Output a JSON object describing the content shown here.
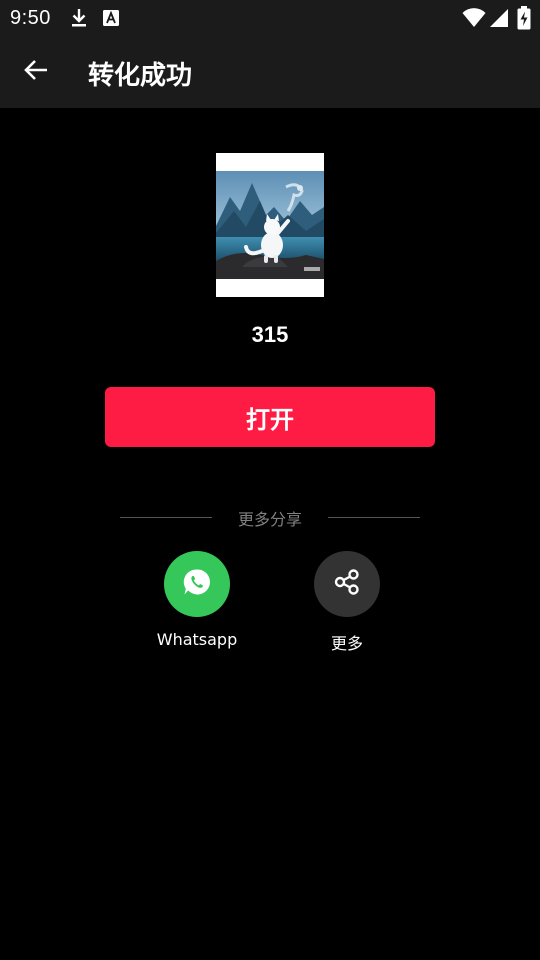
{
  "status_bar": {
    "time": "9:50",
    "icons": [
      "download-icon",
      "text-a-icon",
      "wifi-icon",
      "signal-icon",
      "battery-charging-icon"
    ]
  },
  "app_bar": {
    "back_icon": "arrow-left-icon",
    "title": "转化成功"
  },
  "file": {
    "name": "315"
  },
  "open_button": {
    "label": "打开",
    "color": "#fe1c44"
  },
  "share": {
    "section_label": "更多分享",
    "options": [
      {
        "label": "Whatsapp",
        "icon": "whatsapp-icon",
        "color": "#35c759"
      },
      {
        "label": "更多",
        "icon": "share-icon",
        "color": "#333333"
      }
    ]
  }
}
